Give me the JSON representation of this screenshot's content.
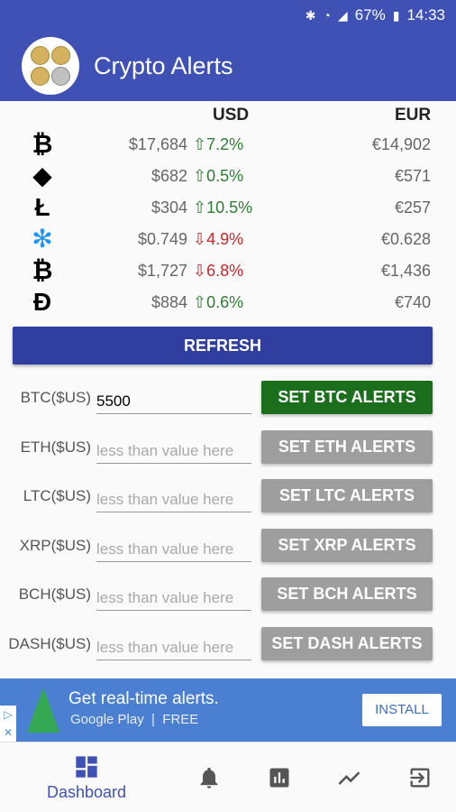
{
  "status": {
    "battery": "67%",
    "time": "14:33"
  },
  "app": {
    "title": "Crypto Alerts"
  },
  "table": {
    "headers": {
      "usd": "USD",
      "eur": "EUR"
    },
    "rows": [
      {
        "coin_glyph": "₿",
        "usd": "$17,684",
        "change": "⇧7.2%",
        "direction": "up",
        "eur": "€14,902"
      },
      {
        "coin_glyph": "◆",
        "usd": "$682",
        "change": "⇧0.5%",
        "direction": "up",
        "eur": "€571"
      },
      {
        "coin_glyph": "Ł",
        "usd": "$304",
        "change": "⇧10.5%",
        "direction": "up",
        "eur": "€257"
      },
      {
        "coin_glyph": "✻",
        "usd": "$0.749",
        "change": "⇩4.9%",
        "direction": "down",
        "eur": "€0.628"
      },
      {
        "coin_glyph": "₿",
        "usd": "$1,727",
        "change": "⇩6.8%",
        "direction": "down",
        "eur": "€1,436"
      },
      {
        "coin_glyph": "Đ",
        "usd": "$884",
        "change": "⇧0.6%",
        "direction": "up",
        "eur": "€740"
      }
    ]
  },
  "refresh": {
    "label": "REFRESH"
  },
  "alerts": [
    {
      "label": "BTC($US)",
      "value": "5500",
      "placeholder": "less than value here",
      "button": "SET BTC ALERTS"
    },
    {
      "label": "ETH($US)",
      "value": "",
      "placeholder": "less than value here",
      "button": "SET ETH ALERTS"
    },
    {
      "label": "LTC($US)",
      "value": "",
      "placeholder": "less than value here",
      "button": "SET LTC ALERTS"
    },
    {
      "label": "XRP($US)",
      "value": "",
      "placeholder": "less than value here",
      "button": "SET XRP ALERTS"
    },
    {
      "label": "BCH($US)",
      "value": "",
      "placeholder": "less than value here",
      "button": "SET BCH ALERTS"
    },
    {
      "label": "DASH($US)",
      "value": "",
      "placeholder": "less than value here",
      "button": "SET DASH ALERTS"
    }
  ],
  "ad": {
    "headline": "Get real-time alerts.",
    "store": "Google Play",
    "price": "FREE",
    "cta": "INSTALL"
  },
  "nav": {
    "dashboard": "Dashboard"
  },
  "colors": {
    "primary": "#3f51b5",
    "refresh": "#303f9f",
    "active_alert": "#1b6e1b",
    "up": "#2e7d32",
    "down": "#c62828"
  }
}
